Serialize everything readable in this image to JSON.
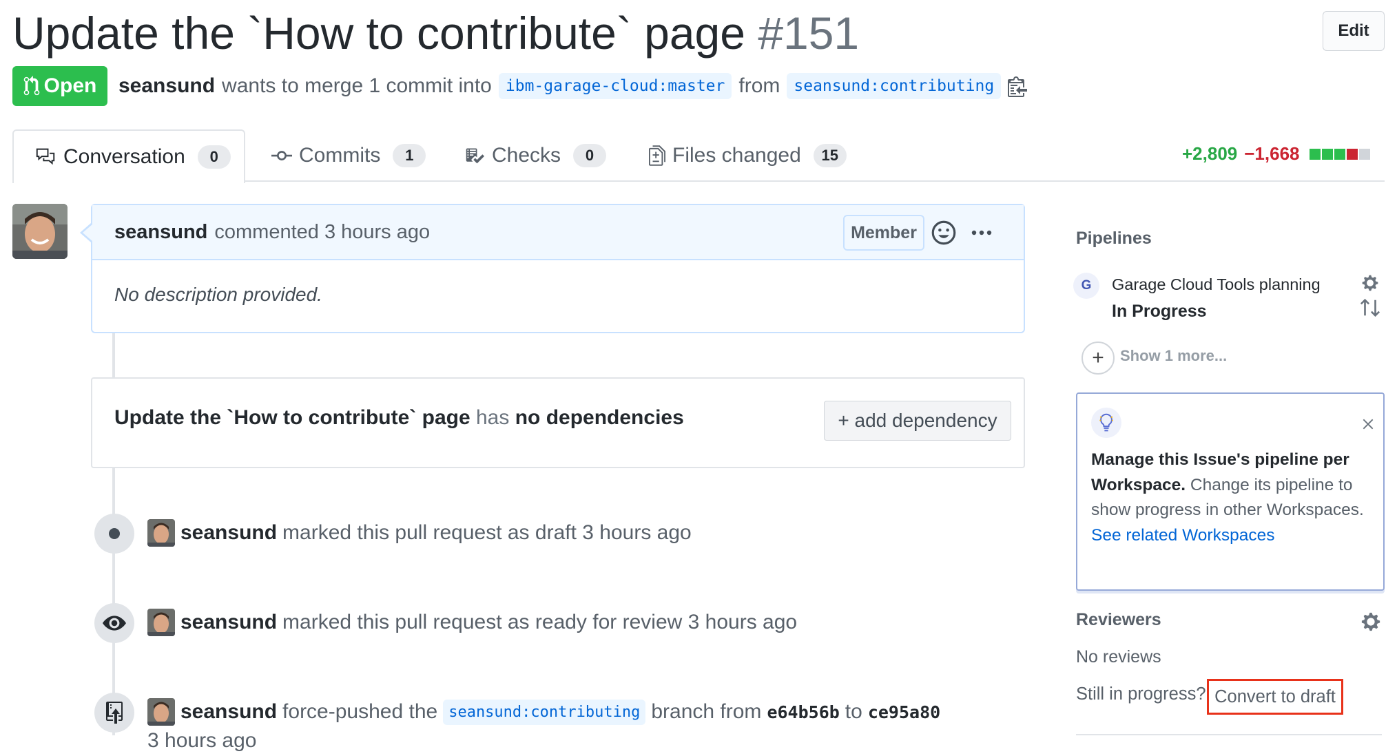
{
  "header": {
    "title": "Update the `How to contribute` page",
    "number": "#151",
    "edit_label": "Edit",
    "state": "Open",
    "author": "seansund",
    "merge_text": "wants to merge 1 commit into",
    "base_branch": "ibm-garage-cloud:master",
    "from_text": "from",
    "head_branch": "seansund:contributing"
  },
  "tabs": [
    {
      "label": "Conversation",
      "count": "0",
      "icon": "comment-discussion-icon"
    },
    {
      "label": "Commits",
      "count": "1",
      "icon": "git-commit-icon"
    },
    {
      "label": "Checks",
      "count": "0",
      "icon": "checklist-icon"
    },
    {
      "label": "Files changed",
      "count": "15",
      "icon": "file-diff-icon"
    }
  ],
  "diffstat": {
    "additions": "+2,809",
    "deletions": "−1,668",
    "colors": {
      "add": "#2cbe4e",
      "del": "#cb2431",
      "neutral": "#d1d5da"
    }
  },
  "comment": {
    "author": "seansund",
    "action": "commented 3 hours ago",
    "badge": "Member",
    "body": "No description provided."
  },
  "dependency": {
    "title": "Update the `How to contribute` page",
    "has": "has",
    "none": "no dependencies",
    "button": "+ add dependency"
  },
  "events": [
    {
      "author": "seansund",
      "text": "marked this pull request as draft 3 hours ago",
      "icon": "dot-icon"
    },
    {
      "author": "seansund",
      "text": "marked this pull request as ready for review 3 hours ago",
      "icon": "eye-icon"
    },
    {
      "author": "seansund",
      "text": "force-pushed the",
      "branch": "seansund:contributing",
      "text2": "branch from",
      "from_sha": "e64b56b",
      "to": "to",
      "to_sha": "ce95a80",
      "time": "3 hours ago",
      "icon": "repo-push-icon"
    }
  ],
  "sidebar": {
    "pipelines_heading": "Pipelines",
    "pipeline_initial": "G",
    "pipeline_name": "Garage Cloud Tools planning",
    "pipeline_status": "In Progress",
    "show_more": "Show 1 more...",
    "tip_bold": "Manage this Issue's pipeline per Workspace.",
    "tip_text": "Change its pipeline to show progress in other Workspaces.",
    "tip_link": "See related Workspaces",
    "reviewers_heading": "Reviewers",
    "no_reviews": "No reviews",
    "still_in_progress": "Still in progress?",
    "convert_to_draft": "Convert to draft"
  }
}
